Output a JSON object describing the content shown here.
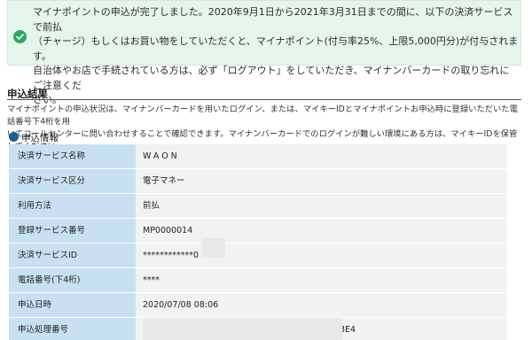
{
  "notice": {
    "text": "マイナポイントの申込が完了しました。2020年9月1日から2021年3月31日までの間に、以下の決済サービスで前払\n（チャージ）もしくはお買い物をしていただくと、マイナポイント(付与率25%、上限5,000円分)が付与されます。\n自治体やお店で手続されている方は、必ず「ログアウト」をしていただき、マイナンバーカードの取り忘れにご注意くだ\nさい。"
  },
  "section": {
    "title": "申込結果"
  },
  "description": "マイナポイントの申込状況は、マイナンバーカードを用いたログイン、または、マイキーIDとマイナポイントお申込時に登録いただいた電話番号下4桁を用\nいてコールセンターに問い合わせすることで確認できます。マイナンバーカードでのログインが難しい環境にある方は、マイキーIDを保管してください。",
  "subsection": {
    "title": "申込情報"
  },
  "rows": [
    {
      "label": "決済サービス名称",
      "value": "WAON"
    },
    {
      "label": "決済サービス区分",
      "value": "電子マネー"
    },
    {
      "label": "利用方法",
      "value": "前払"
    },
    {
      "label": "登録サービス番号",
      "value": "MP0000014"
    },
    {
      "label": "決済サービスID",
      "value": "************0"
    },
    {
      "label": "電話番号(下4桁)",
      "value": "****"
    },
    {
      "label": "申込日時",
      "value": "2020/07/08 08:06"
    },
    {
      "label": "申込処理番号",
      "value": "3E4"
    }
  ],
  "colors": {
    "notice_bg": "#e6f5ec",
    "check_green": "#2ea66a",
    "label_bg": "#c8e1f2",
    "value_bg": "#f2f2f2",
    "bullet": "#1f5f8b"
  },
  "icons": {
    "notice": "check-circle-icon",
    "subsection": "bullet-dot-icon"
  }
}
